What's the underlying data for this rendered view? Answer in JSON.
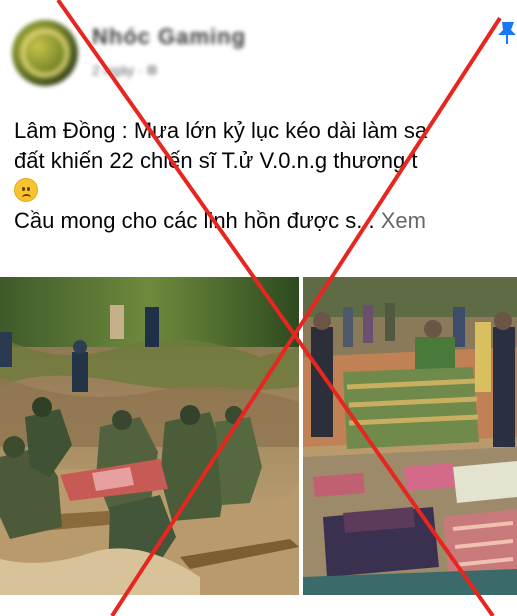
{
  "post": {
    "page_name": "Nhóc Gaming",
    "meta": "2 ngày · ",
    "lines": [
      "Lâm Đồng : Mưa lớn kỷ lục kéo dài làm sạ",
      "đất khiến 22 chiến sĩ  T.ử V.0.n.g thương t",
      "Cầu mong cho các linh hồn được s..."
    ],
    "see_more": "Xem",
    "emoji": "sad-face-icon"
  },
  "photos": [
    {
      "name": "rescue-mud-photo"
    },
    {
      "name": "covered-bodies-photo"
    }
  ],
  "overlay": {
    "cross_color": "#e6261f"
  }
}
